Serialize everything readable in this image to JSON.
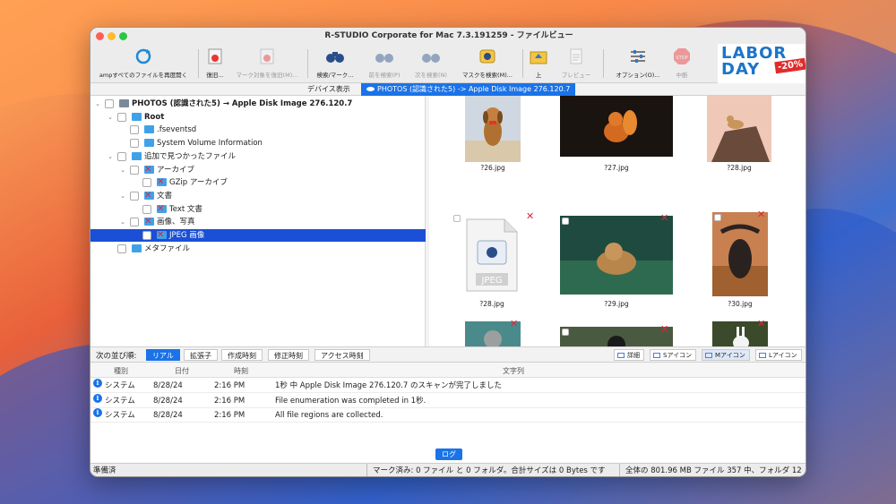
{
  "window": {
    "title": "R-STUDIO Corporate for Mac 7.3.191259 - ファイルビュー"
  },
  "toolbar": {
    "items": [
      {
        "label": "ampすべてのファイルを再度開く",
        "icon": "refresh-icon",
        "enabled": true
      },
      {
        "label": "復旧...",
        "icon": "recover-icon",
        "enabled": true
      },
      {
        "label": "マーク対象を復旧(M)...",
        "icon": "recover-marked-icon",
        "enabled": false
      },
      {
        "label": "検索/マーク...",
        "icon": "binoculars-icon",
        "enabled": true
      },
      {
        "label": "前を検索(P)",
        "icon": "find-previous-icon",
        "enabled": false
      },
      {
        "label": "次を検索(N)",
        "icon": "find-next-icon",
        "enabled": false
      },
      {
        "label": "マスクを検索(M)...",
        "icon": "mask-search-icon",
        "enabled": true
      },
      {
        "label": "上",
        "icon": "folder-up-icon",
        "enabled": true
      },
      {
        "label": "プレビュー",
        "icon": "preview-icon",
        "enabled": false
      },
      {
        "label": "オプション(O)...",
        "icon": "options-sliders-icon",
        "enabled": true
      },
      {
        "label": "中断",
        "icon": "stop-icon",
        "enabled": false
      }
    ],
    "promo": {
      "line1": "LABOR",
      "line2": "DAY",
      "badge": "-20%"
    }
  },
  "tabs": {
    "device": "デバイス表示",
    "current": "PHOTOS (認識された5) -> Apple Disk Image 276.120.7"
  },
  "tree": {
    "items": [
      {
        "label": "PHOTOS (認識された5) → Apple Disk Image 276.120.7",
        "type": "disk",
        "level": 0,
        "deleted": false,
        "selected": false,
        "bold": true
      },
      {
        "label": "Root",
        "type": "folder",
        "level": 1,
        "deleted": false,
        "selected": false,
        "bold": true
      },
      {
        "label": ".fseventsd",
        "type": "folder",
        "level": 2,
        "deleted": false,
        "selected": false,
        "bold": false
      },
      {
        "label": "System Volume Information",
        "type": "folder",
        "level": 2,
        "deleted": false,
        "selected": false,
        "bold": false
      },
      {
        "label": "追加で見つかったファイル",
        "type": "folder",
        "level": 1,
        "deleted": false,
        "selected": false,
        "bold": false
      },
      {
        "label": "アーカイブ",
        "type": "folder",
        "level": 2,
        "deleted": true,
        "selected": false,
        "bold": false
      },
      {
        "label": "GZip アーカイブ",
        "type": "folder",
        "level": 3,
        "deleted": true,
        "selected": false,
        "bold": false
      },
      {
        "label": "文書",
        "type": "folder",
        "level": 2,
        "deleted": true,
        "selected": false,
        "bold": false
      },
      {
        "label": "Text 文書",
        "type": "folder",
        "level": 3,
        "deleted": true,
        "selected": false,
        "bold": false
      },
      {
        "label": "画像、写真",
        "type": "folder",
        "level": 2,
        "deleted": true,
        "selected": false,
        "bold": false
      },
      {
        "label": "JPEG 画像",
        "type": "folder",
        "level": 3,
        "deleted": true,
        "selected": true,
        "bold": false
      },
      {
        "label": "メタファイル",
        "type": "folder",
        "level": 1,
        "deleted": false,
        "selected": false,
        "bold": false
      }
    ]
  },
  "thumbnails": {
    "items": [
      {
        "name": "?26.jpg",
        "subject": "puppy on beach"
      },
      {
        "name": "?27.jpg",
        "subject": "red squirrel"
      },
      {
        "name": "?28.jpg",
        "subject": "lion on rock"
      },
      {
        "name": "?28.jpg",
        "subject": "jpeg file icon",
        "placeholder": "JPEG"
      },
      {
        "name": "?29.jpg",
        "subject": "lioness in grass"
      },
      {
        "name": "?30.jpg",
        "subject": "buffalo"
      },
      {
        "name": "",
        "subject": "koala"
      },
      {
        "name": "",
        "subject": "gorilla"
      },
      {
        "name": "",
        "subject": "white rabbit"
      }
    ]
  },
  "sort": {
    "label": "次の並び順:",
    "options": [
      "リアル",
      "拡張子",
      "作成時刻",
      "修正時刻",
      "アクセス時刻"
    ],
    "active": "リアル"
  },
  "views": {
    "options": [
      "詳細",
      "Sアイコン",
      "Mアイコン",
      "Lアイコン"
    ],
    "active": "Mアイコン"
  },
  "log": {
    "columns": [
      "種別",
      "日付",
      "時刻",
      "文字列"
    ],
    "rows": [
      {
        "type": "システム",
        "date": "8/28/24",
        "time": "2:16 PM",
        "message": "1秒 中 Apple Disk Image 276.120.7 のスキャンが完了しました"
      },
      {
        "type": "システム",
        "date": "8/28/24",
        "time": "2:16 PM",
        "message": "File enumeration was completed in 1秒."
      },
      {
        "type": "システム",
        "date": "8/28/24",
        "time": "2:16 PM",
        "message": "All file regions are collected."
      }
    ],
    "tab_label": "ログ"
  },
  "status": {
    "ready": "準備済",
    "marked": "マーク済み: 0 ファイル と 0 フォルダ。合計サイズは 0 Bytes です",
    "total": "全体の 801.96 MB ファイル 357 中、フォルダ 12"
  },
  "colors": {
    "accent": "#1a73e8",
    "selection": "#1a4fd6",
    "deleted": "#e0263a",
    "folder": "#3fa2e8",
    "promo_blue": "#1e74c8",
    "promo_red": "#e02b2b"
  }
}
